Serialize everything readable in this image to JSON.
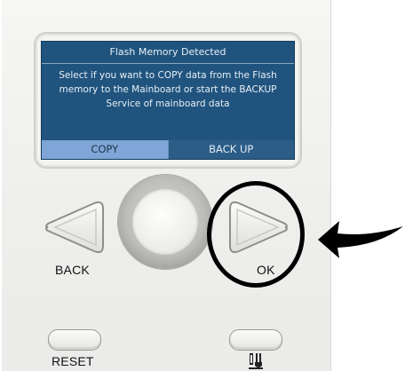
{
  "screen": {
    "title": "Flash Memory Detected",
    "message": "Select if you want to COPY data from the Flash memory to the Mainboard or start the BACKUP Service of mainboard data",
    "softkeys": [
      {
        "label": "COPY",
        "selected": true
      },
      {
        "label": "BACK UP",
        "selected": false
      }
    ]
  },
  "buttons": {
    "back_label": "BACK",
    "ok_label": "OK",
    "reset_label": "RESET",
    "service_icon": "service-tools-icon"
  },
  "colors": {
    "screen_bg": "#20547e",
    "selected_softkey": "#7fa6d6",
    "annotation": "#000000"
  }
}
